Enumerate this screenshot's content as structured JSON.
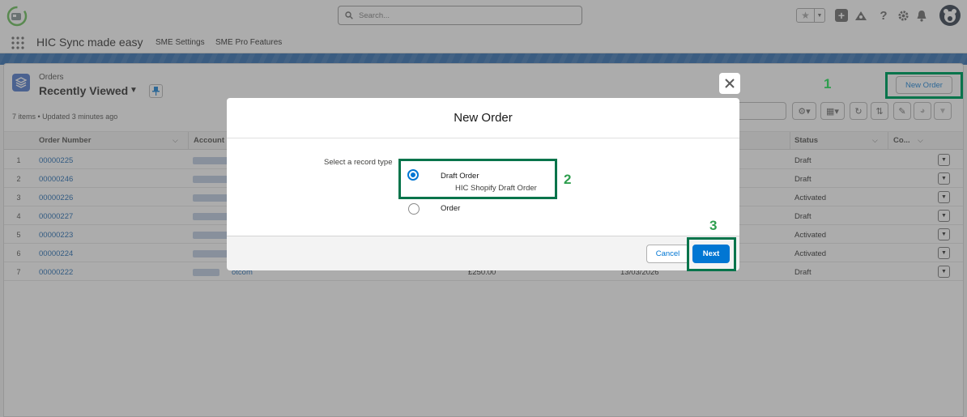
{
  "header": {
    "search_placeholder": "Search...",
    "app_name": "HIC Sync made easy",
    "nav": [
      "SME Settings",
      "SME Pro Features"
    ]
  },
  "list_view": {
    "object_label": "Orders",
    "title": "Recently Viewed",
    "meta": "7 items • Updated 3 minutes ago",
    "new_button": "New Order",
    "columns": [
      "Order Number",
      "Account",
      "Status",
      "Co..."
    ],
    "rows": [
      {
        "index": "1",
        "order_number": "00000225",
        "status": "Draft"
      },
      {
        "index": "2",
        "order_number": "00000246",
        "status": "Draft"
      },
      {
        "index": "3",
        "order_number": "00000226",
        "status": "Activated"
      },
      {
        "index": "4",
        "order_number": "00000227",
        "status": "Draft"
      },
      {
        "index": "5",
        "order_number": "00000223",
        "status": "Activated"
      },
      {
        "index": "6",
        "order_number": "00000224",
        "status": "Activated"
      },
      {
        "index": "7",
        "order_number": "00000222",
        "status": "Draft",
        "account_tail": "otcom",
        "amount": "£250.00",
        "date": "13/03/2026"
      }
    ]
  },
  "modal": {
    "title": "New Order",
    "field_label": "Select a record type",
    "options": [
      {
        "label": "Draft Order",
        "description": "HIC Shopify Draft Order",
        "selected": true
      },
      {
        "label": "Order",
        "description": "",
        "selected": false
      }
    ],
    "cancel_label": "Cancel",
    "next_label": "Next"
  },
  "annotations": {
    "step1": "1",
    "step2": "2",
    "step3": "3"
  },
  "colors": {
    "brand_blue": "#0176d3",
    "link_blue": "#0b5cab",
    "highlight_green": "#07744b",
    "step_green": "#2e9e4e"
  }
}
